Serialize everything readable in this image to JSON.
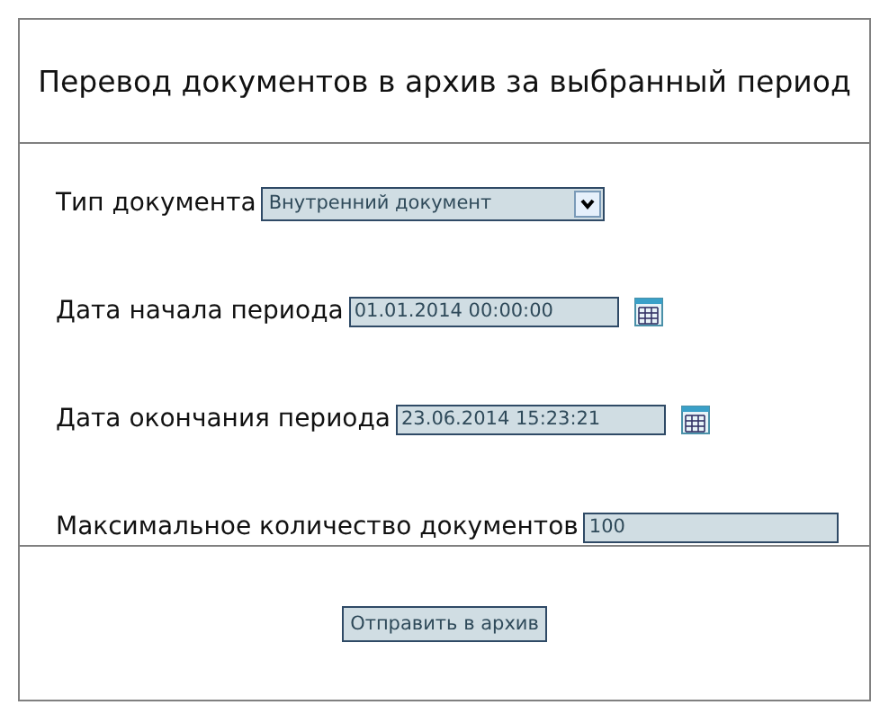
{
  "title": "Перевод документов в архив за выбранный период",
  "fields": [
    {
      "kind": "select",
      "label": "Тип документа",
      "value": "Внутренний документ"
    },
    {
      "kind": "date",
      "label": "Дата начала периода",
      "value": "01.01.2014 00:00:00"
    },
    {
      "kind": "date",
      "label": "Дата окончания периода",
      "value": "23.06.2014 15:23:21"
    },
    {
      "kind": "text",
      "label": "Максимальное количество документов",
      "value": "100"
    }
  ],
  "submit_button": "Отправить в архив"
}
